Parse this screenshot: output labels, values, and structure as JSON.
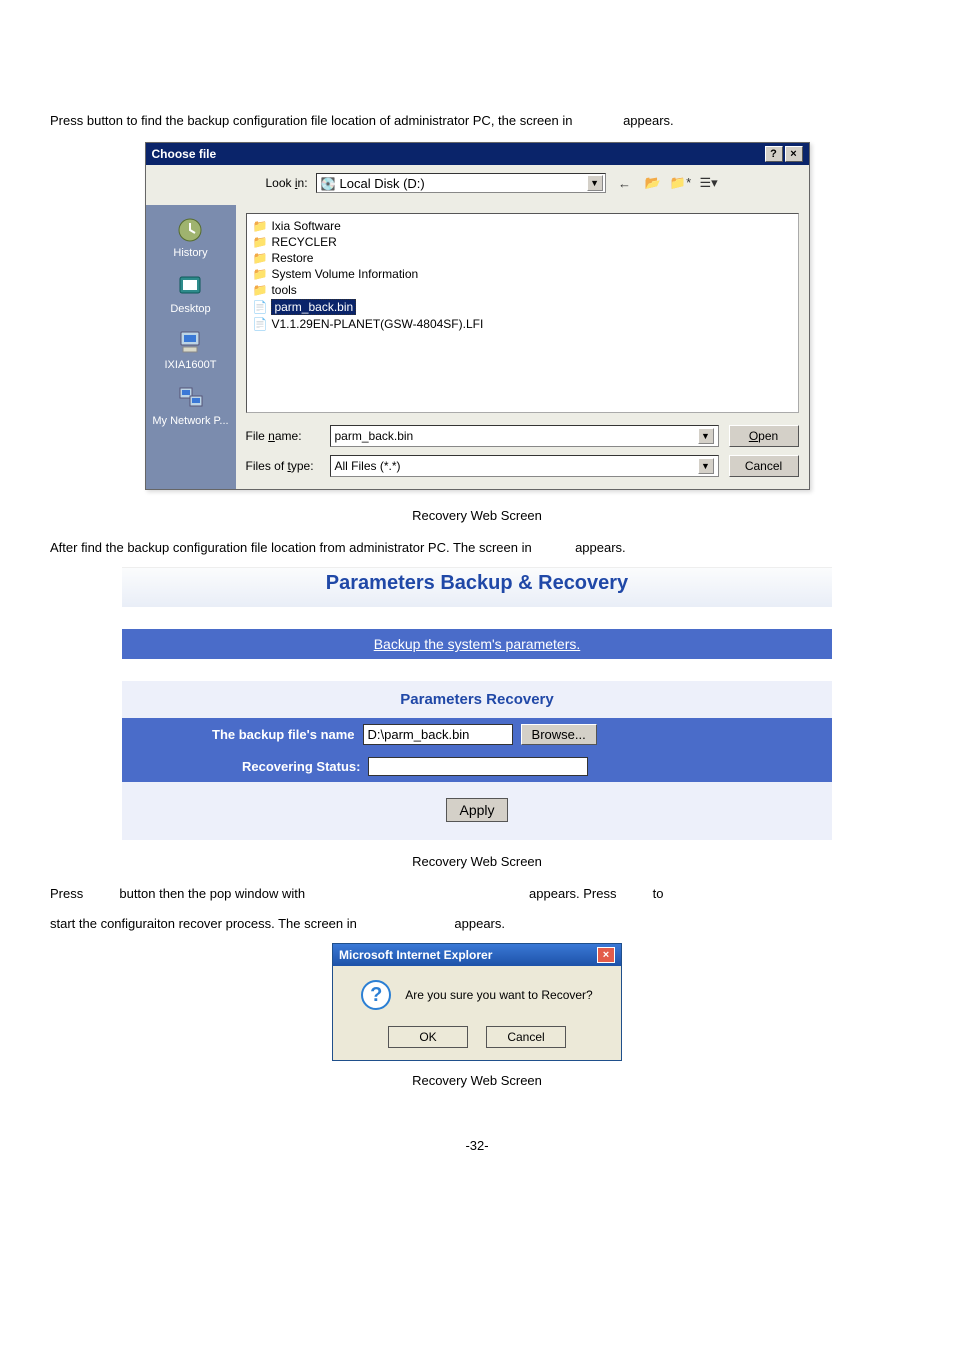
{
  "intro": {
    "press_label": "Press",
    "line1_rest": " button to find the backup configuration file location of administrator PC, the screen in ",
    "appears": "appears."
  },
  "choose_dialog": {
    "title": "Choose file",
    "help_btn": "?",
    "close_btn": "×",
    "lookin_label": "Look in:",
    "lookin_value": "Local Disk (D:)",
    "places": {
      "history": "History",
      "desktop": "Desktop",
      "ix": "IXIA1600T",
      "network": "My Network P..."
    },
    "files": [
      {
        "name": "Ixia Software",
        "type": "folder"
      },
      {
        "name": "RECYCLER",
        "type": "folder"
      },
      {
        "name": "Restore",
        "type": "folder"
      },
      {
        "name": "System Volume Information",
        "type": "folder"
      },
      {
        "name": "tools",
        "type": "folder"
      },
      {
        "name": "parm_back.bin",
        "type": "file",
        "selected": true
      },
      {
        "name": "V1.1.29EN-PLANET(GSW-4804SF).LFI",
        "type": "file"
      }
    ],
    "filename_label": "File name:",
    "filename_value": "parm_back.bin",
    "filetype_label": "Files of type:",
    "filetype_value": "All Files (*.*)",
    "open_btn": "Open",
    "cancel_btn": "Cancel"
  },
  "caption1": "Recovery Web Screen",
  "after_find": {
    "text": "After find the backup configuration file location from administrator PC. The screen in ",
    "appears": "appears."
  },
  "panel": {
    "title": "Parameters Backup & Recovery",
    "backup_link": "Backup the system's parameters.",
    "sub": "Parameters Recovery",
    "row1_label": "The backup file's name",
    "row1_value": "D:\\parm_back.bin",
    "browse": "Browse...",
    "row2_label": "Recovering Status:",
    "apply": "Apply"
  },
  "caption2": "Recovery Web Screen",
  "press_apply": {
    "press": "Press ",
    "mid": " button then the pop window with ",
    "appears_press": "appears. Press ",
    "to": " to"
  },
  "start_line": {
    "text": "start the configuraiton recover process. The screen in ",
    "appears": "appears."
  },
  "ie_dialog": {
    "title": "Microsoft Internet Explorer",
    "close": "×",
    "msg": "Are you sure you want to Recover?",
    "ok": "OK",
    "cancel": "Cancel"
  },
  "caption3": "Recovery Web Screen",
  "page_num": "-32-"
}
